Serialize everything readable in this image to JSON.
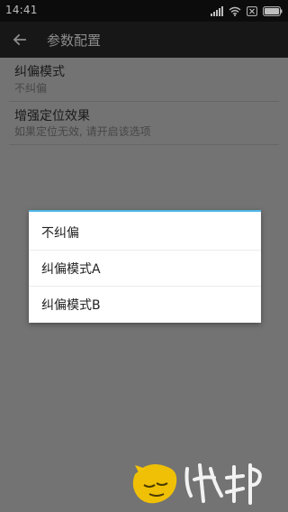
{
  "status_bar": {
    "time": "14:41",
    "icons": [
      "signal-icon",
      "wifi-icon",
      "sim-x-icon",
      "battery-icon"
    ]
  },
  "app_bar": {
    "title": "参数配置",
    "back_icon": "back-arrow-icon"
  },
  "settings": [
    {
      "title": "纠偏模式",
      "summary": "不纠偏"
    },
    {
      "title": "增强定位效果",
      "summary": "如果定位无效, 请开启该选项"
    }
  ],
  "dialog": {
    "options": [
      "不纠偏",
      "纠偏模式A",
      "纠偏模式B"
    ],
    "accent_color": "#4db6e6"
  },
  "watermark": {
    "text": "",
    "logo_text": ""
  }
}
